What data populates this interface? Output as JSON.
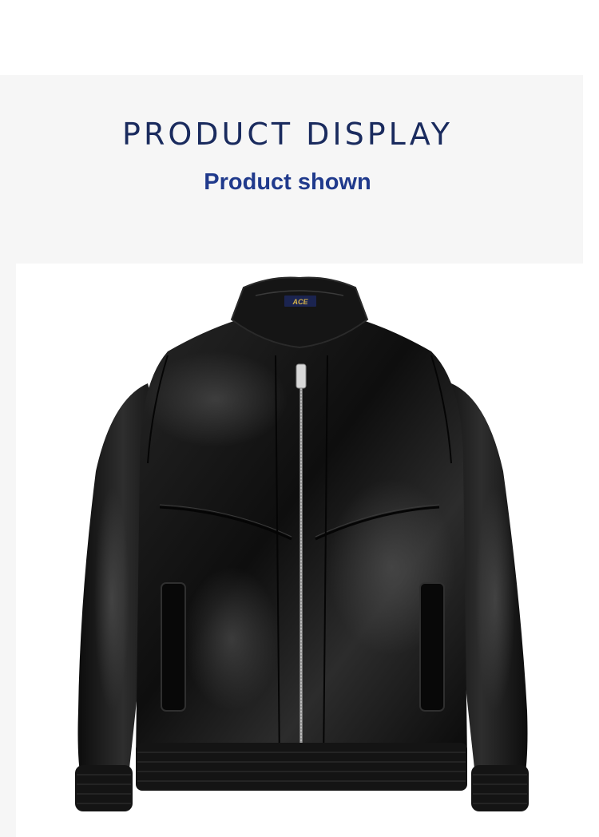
{
  "header": {
    "title": "PRODUCT DISPLAY",
    "subtitle": "Product shown"
  },
  "product": {
    "label_text": "ACE",
    "colors": {
      "leather": "#111111",
      "highlight": "#3a3a3a",
      "zipper": "#c8c8c8",
      "title": "#1a2b5e",
      "subtitle": "#203a8c",
      "panel": "#f6f6f6"
    }
  }
}
